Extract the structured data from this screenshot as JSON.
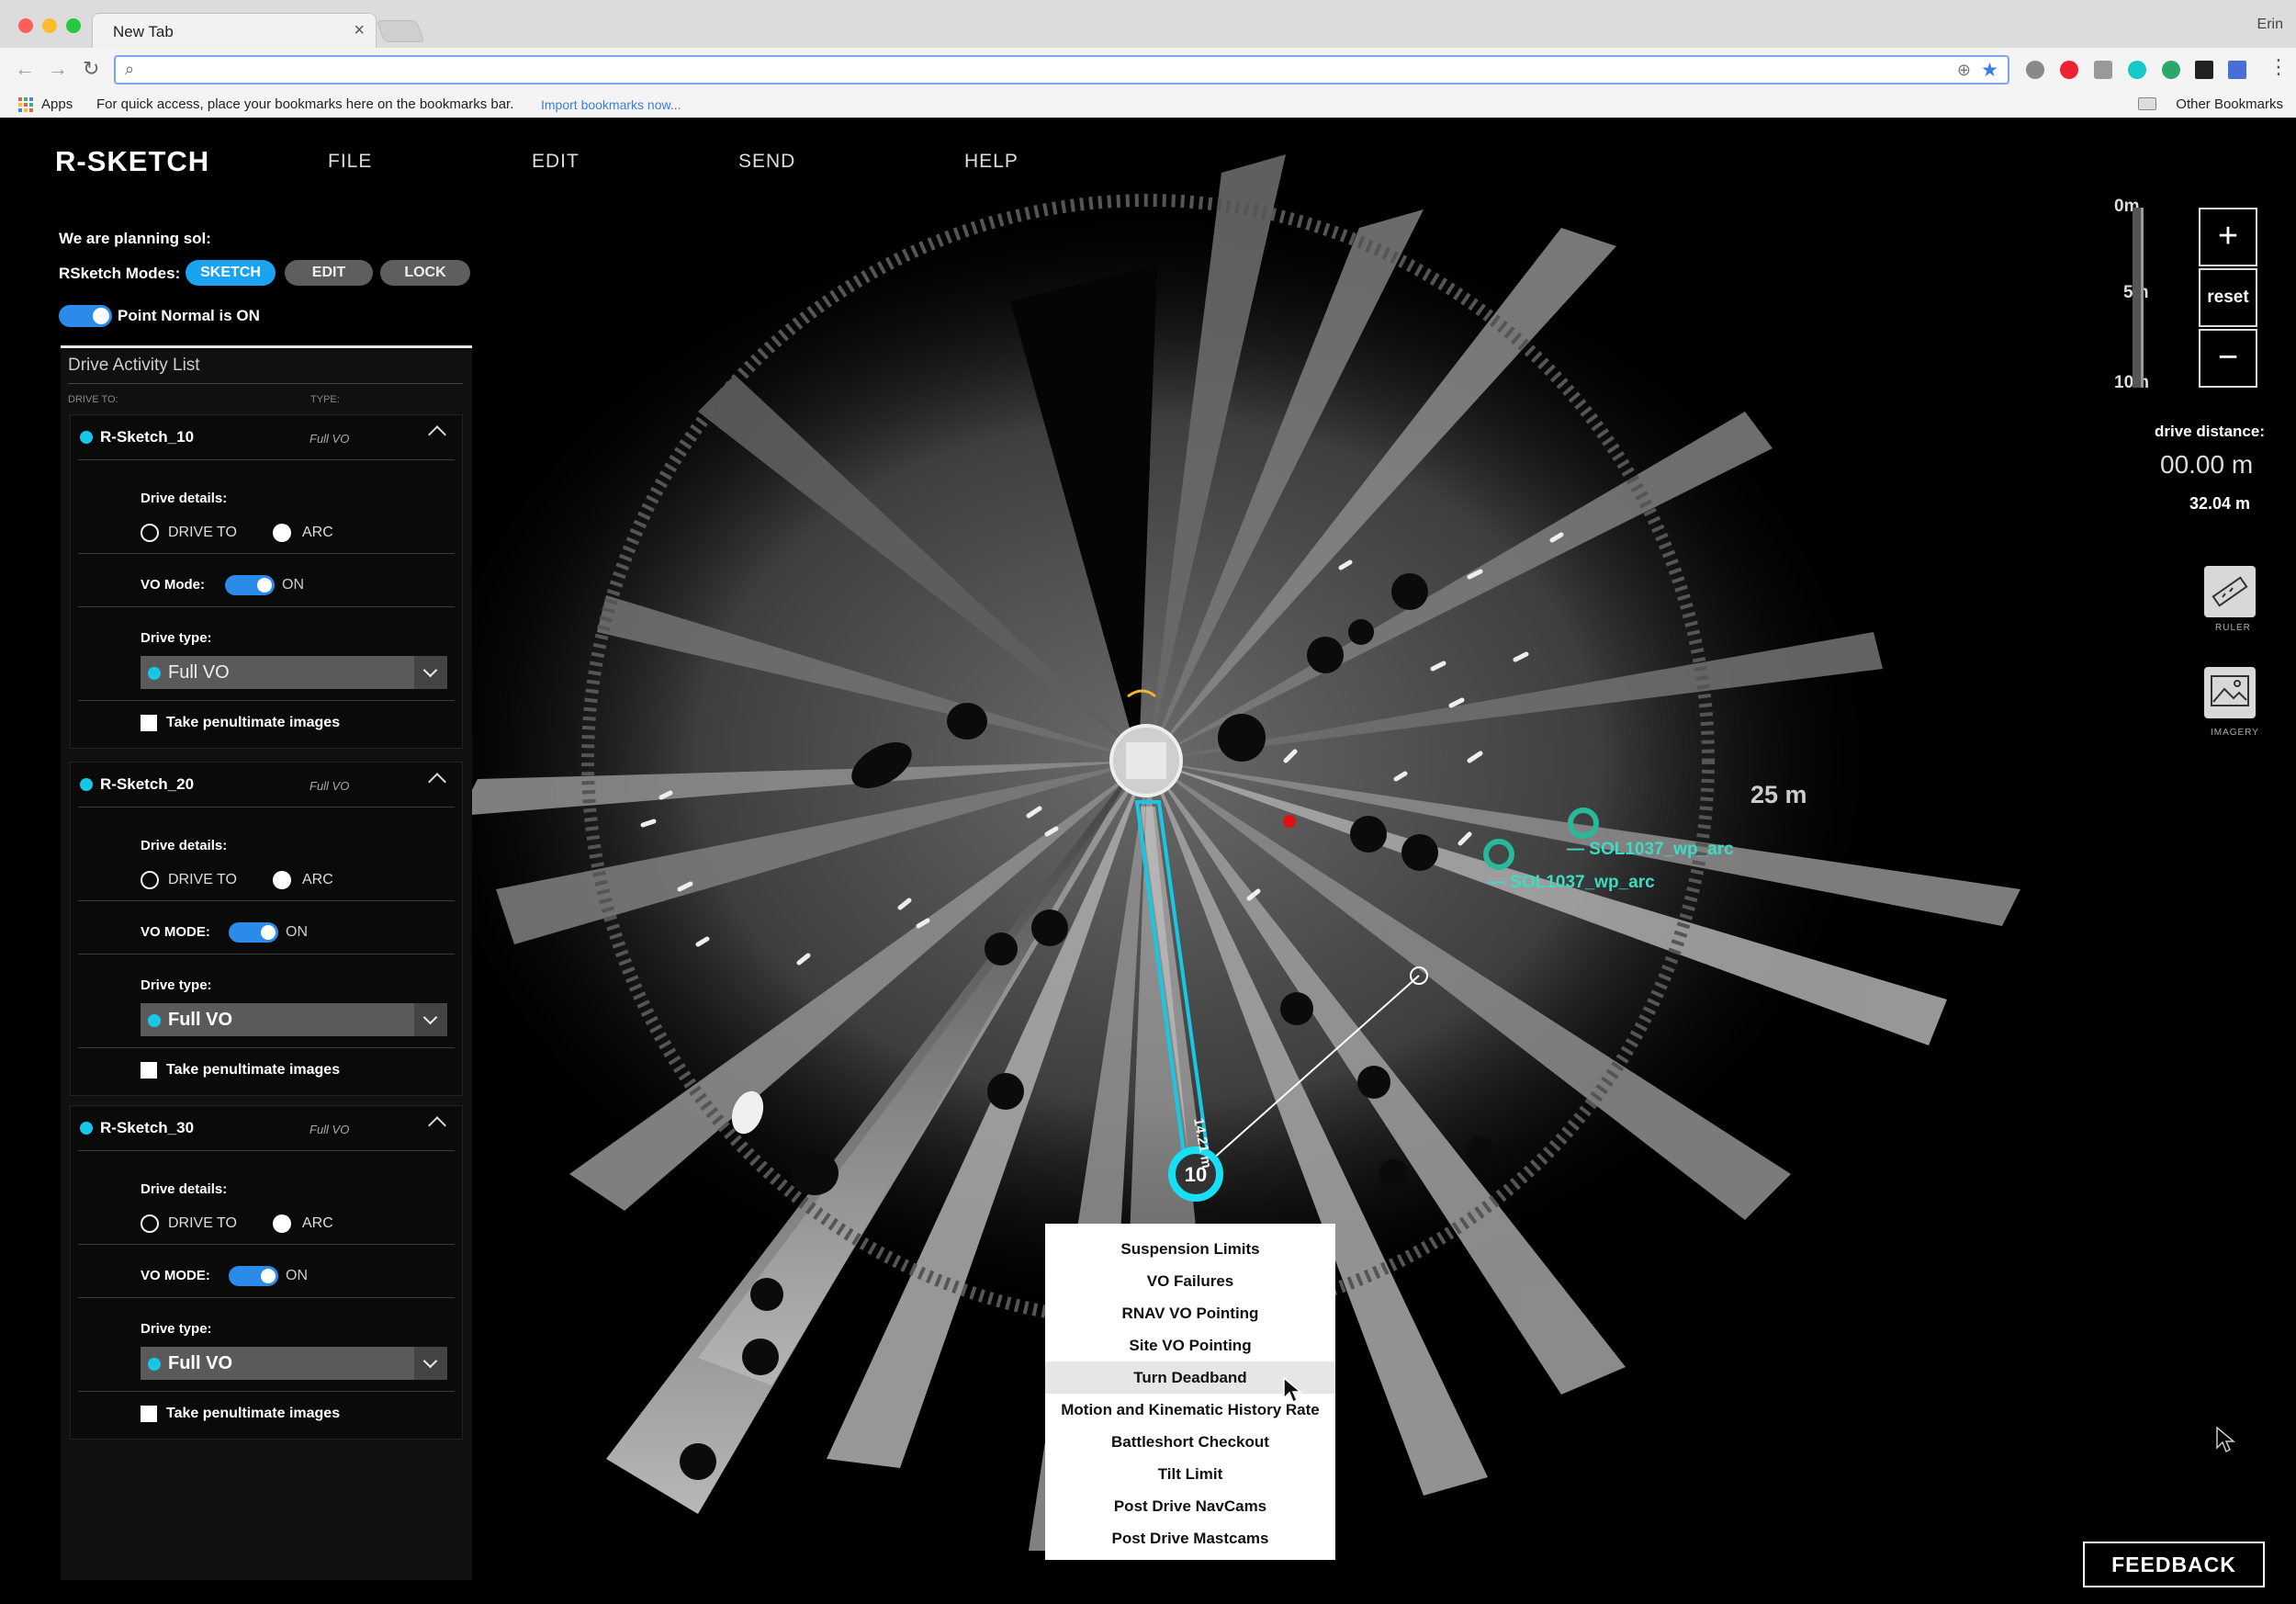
{
  "browser": {
    "tab_title": "New Tab",
    "tab_close": "×",
    "user_name": "Erin",
    "address_value": "",
    "bookmarks": {
      "apps_label": "Apps",
      "hint": "For quick access, place your bookmarks here on the bookmarks bar.",
      "import_link": "Import bookmarks now...",
      "other": "Other Bookmarks"
    }
  },
  "app": {
    "logo": "R-SKETCH",
    "menu": [
      "FILE",
      "EDIT",
      "SEND",
      "HELP"
    ],
    "planning_label": "We are planning sol:",
    "modes_label": "RSketch Modes:",
    "modes": [
      {
        "label": "SKETCH",
        "active": true
      },
      {
        "label": "EDIT",
        "active": false
      },
      {
        "label": "LOCK",
        "active": false
      }
    ],
    "point_normal_label": "Point Normal is ON",
    "activity_list": {
      "title": "Drive Activity List",
      "col_drive_to": "DRIVE TO:",
      "col_type": "TYPE:",
      "cards": [
        {
          "name": "R-Sketch_10",
          "type": "Full VO",
          "drive_details_label": "Drive details:",
          "radio_drive_to": "DRIVE TO",
          "radio_arc": "ARC",
          "vo_mode_label": "VO Mode:",
          "vo_state": "ON",
          "drive_type_label": "Drive type:",
          "drive_type_value": "Full VO",
          "penultimate_label": "Take penultimate images"
        },
        {
          "name": "R-Sketch_20",
          "type": "Full VO",
          "drive_details_label": "Drive details:",
          "radio_drive_to": "DRIVE TO",
          "radio_arc": "ARC",
          "vo_mode_label": "VO MODE:",
          "vo_state": "ON",
          "drive_type_label": "Drive type:",
          "drive_type_value": "Full VO",
          "penultimate_label": "Take penultimate images"
        },
        {
          "name": "R-Sketch_30",
          "type": "Full VO",
          "drive_details_label": "Drive details:",
          "radio_drive_to": "DRIVE TO",
          "radio_arc": "ARC",
          "vo_mode_label": "VO MODE:",
          "vo_state": "ON",
          "drive_type_label": "Drive type:",
          "drive_type_value": "Full VO",
          "penultimate_label": "Take penultimate images"
        }
      ]
    },
    "scale": {
      "top": "0m",
      "mid": "5m",
      "bottom": "10m"
    },
    "zoom": {
      "plus": "+",
      "reset": "reset",
      "minus": "−"
    },
    "drive_distance": {
      "label": "drive distance:",
      "value": "00.00 m",
      "total": "32.04 m"
    },
    "tools": [
      {
        "label": "RULER",
        "icon": "ruler-icon"
      },
      {
        "label": "IMAGERY",
        "icon": "imagery-icon"
      }
    ],
    "feedback_label": "FEEDBACK"
  },
  "map": {
    "range_label": "25 m",
    "waypoints": [
      {
        "label": "— SOL1037_wp_arc"
      },
      {
        "label": "— SOL1037_wp_arc"
      }
    ],
    "drive_marker_label": "10",
    "path_length_label": "14.21 m",
    "colors": {
      "path": "#17c8e6",
      "waypoint": "#3bdcc3",
      "target": "#e01010"
    }
  },
  "context_menu": {
    "items": [
      "Suspension Limits",
      "VO Failures",
      "RNAV VO Pointing",
      "Site VO Pointing",
      "Turn Deadband",
      "Motion and Kinematic History Rate",
      "Battleshort Checkout",
      "Tilt Limit",
      "Post Drive NavCams",
      "Post Drive Mastcams"
    ],
    "hovered_index": 4
  }
}
